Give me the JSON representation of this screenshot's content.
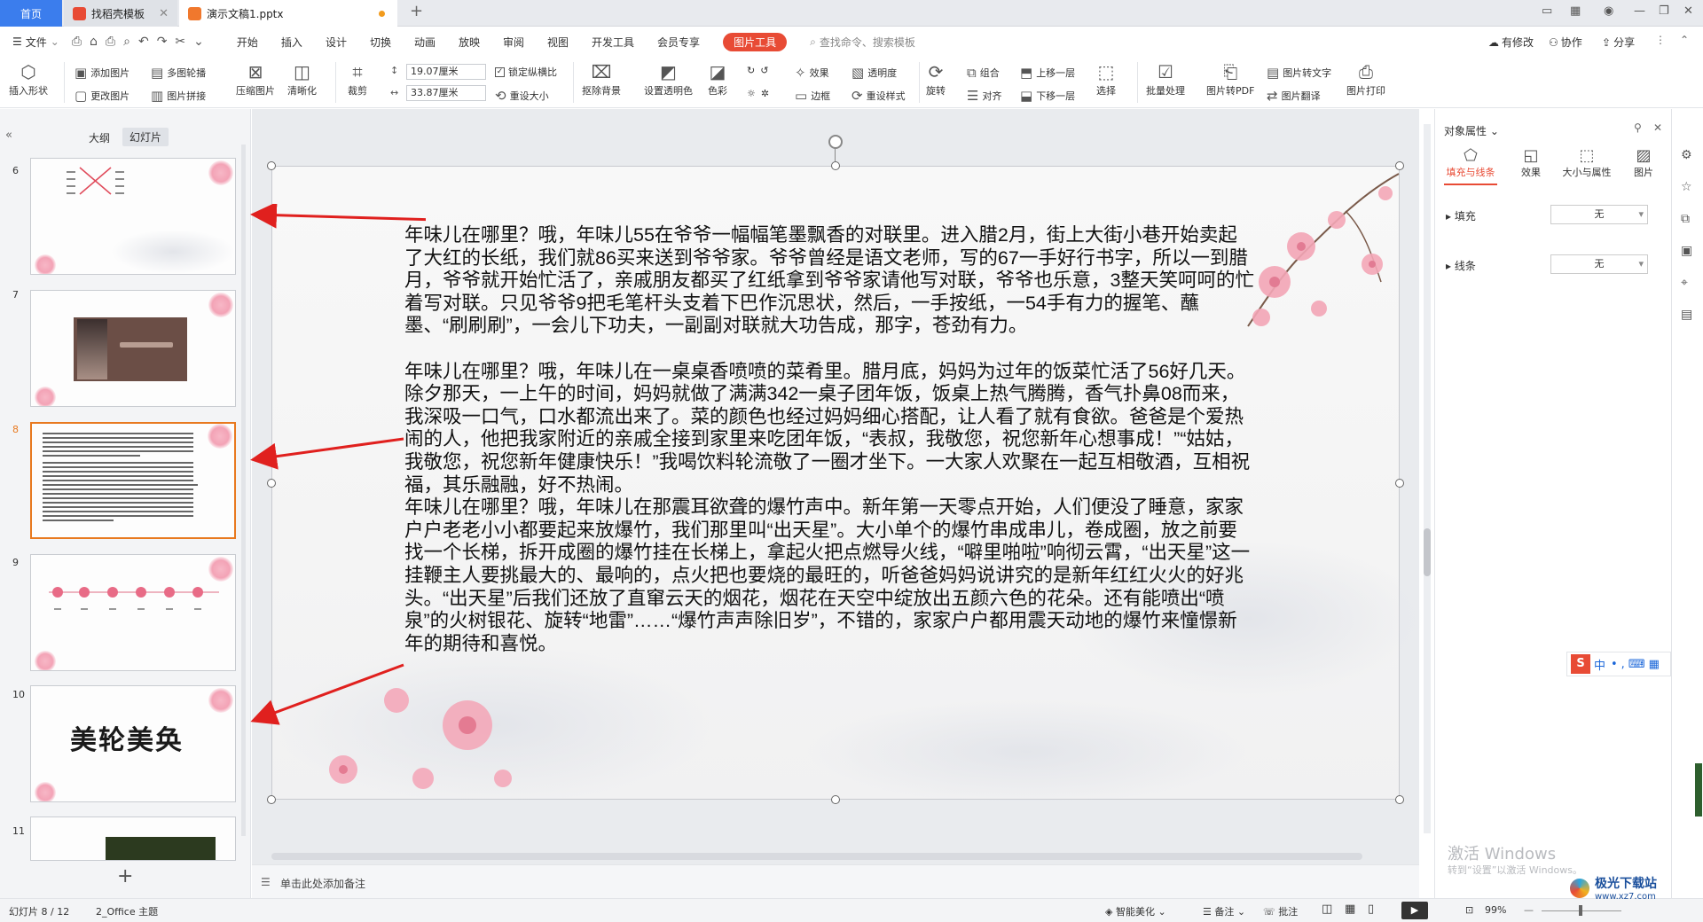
{
  "tabs": {
    "home": "首页",
    "templates": "找稻壳模板",
    "document": "演示文稿1.pptx"
  },
  "menu": {
    "file": "文件",
    "items": [
      "开始",
      "插入",
      "设计",
      "切换",
      "动画",
      "放映",
      "审阅",
      "视图",
      "开发工具",
      "会员专享"
    ],
    "picture_tools": "图片工具",
    "search": "查找命令、搜索模板",
    "modified": "有修改",
    "collaborate": "协作",
    "share": "分享"
  },
  "ribbon": {
    "insert_shape": "插入形状",
    "add_picture": "添加图片",
    "change_picture": "更改图片",
    "multi_outline": "多图轮播",
    "picture_collage": "图片拼接",
    "compress": "压缩图片",
    "sharpen": "清晰化",
    "crop": "裁剪",
    "width_value": "19.07厘米",
    "height_value": "33.87厘米",
    "lock_ratio": "锁定纵横比",
    "reset_size": "重设大小",
    "remove_bg": "抠除背景",
    "set_transparent": "设置透明色",
    "color": "色彩",
    "effects": "效果",
    "border": "边框",
    "transparency": "透明度",
    "reset_style": "重设样式",
    "rotate": "旋转",
    "group": "组合",
    "align": "对齐",
    "bring_forward": "上移一层",
    "send_backward": "下移一层",
    "select": "选择",
    "batch": "批量处理",
    "to_pdf": "图片转PDF",
    "to_text": "图片转文字",
    "translate": "图片翻译",
    "print": "图片打印"
  },
  "left_panel": {
    "tab_outline": "大纲",
    "tab_slides": "幻灯片",
    "slide_numbers": [
      "6",
      "7",
      "8",
      "9",
      "10",
      "11"
    ],
    "thumb10_title": "美轮美奂"
  },
  "slide_text": {
    "p1": "年味儿在哪里？哦，年味儿55在爷爷一幅幅笔墨飘香的对联里。进入腊2月，街上大街小巷开始卖起了大红的长纸，我们就86买来送到爷爷家。爷爷曾经是语文老师，写的67一手好行书字，所以一到腊月，爷爷就开始忙活了，亲戚朋友都买了红纸拿到爷爷家请他写对联，爷爷也乐意，3整天笑呵呵的忙着写对联。只见爷爷9把毛笔杆头支着下巴作沉思状，然后，一手按纸，一54手有力的握笔、蘸墨、“刷刷刷”，一会儿下功夫，一副副对联就大功告成，那字，苍劲有力。",
    "p2": "年味儿在哪里？哦，年味儿在一桌桌香喷喷的菜肴里。腊月底，妈妈为过年的饭菜忙活了56好几天。除夕那天，一上午的时间，妈妈就做了满满342一桌子团年饭，饭桌上热气腾腾，香气扑鼻08而来，我深吸一口气，口水都流出来了。菜的颜色也经过妈妈细心搭配，让人看了就有食欲。爸爸是个爱热闹的人，他把我家附近的亲戚全接到家里来吃团年饭，“表叔，我敬您，祝您新年心想事成！”“姑姑，我敬您，祝您新年健康快乐！”我喝饮料轮流敬了一圈才坐下。一大家人欢聚在一起互相敬酒，互相祝福，其乐融融，好不热闹。",
    "p3": "年味儿在哪里？哦，年味儿在那震耳欲聋的爆竹声中。新年第一天零点开始，人们便没了睡意，家家户户老老小小都要起来放爆竹，我们那里叫“出天星”。大小单个的爆竹串成串儿，卷成圈，放之前要找一个长梯，拆开成圈的爆竹挂在长梯上，拿起火把点燃导火线，“噼里啪啦”响彻云霄，“出天星”这一挂鞭主人要挑最大的、最响的，点火把也要烧的最旺的，听爸爸妈妈说讲究的是新年红红火火的好兆头。“出天星”后我们还放了直窜云天的烟花，烟花在天空中绽放出五颜六色的花朵。还有能喷出“喷泉”的火树银花、旋转“地雷”……“爆竹声声除旧岁”，不错的，家家户户都用震天动地的爆竹来憧憬新年的期待和喜悦。"
  },
  "notes_placeholder": "单击此处添加备注",
  "right_pane": {
    "title": "对象属性",
    "tab_fill": "填充与线条",
    "tab_effects": "效果",
    "tab_size": "大小与属性",
    "tab_picture": "图片",
    "fill_label": "填充",
    "fill_value": "无",
    "line_label": "线条",
    "line_value": "无"
  },
  "watermark": {
    "line1": "激活 Windows",
    "line2": "转到“设置”以激活 Windows。"
  },
  "brand": "极光下载站",
  "brand_url": "www.xz7.com",
  "ime": "中",
  "statusbar": {
    "slide_pos": "幻灯片 8 / 12",
    "theme": "2_Office 主题",
    "smart_beautify": "智能美化",
    "notes": "备注",
    "comments": "批注",
    "zoom": "99%"
  },
  "colors": {
    "accent_blue": "#3b7ded",
    "picture_tools_red": "#e84b35",
    "selected_border": "#e8791f",
    "arrow_red": "#e0201e"
  }
}
